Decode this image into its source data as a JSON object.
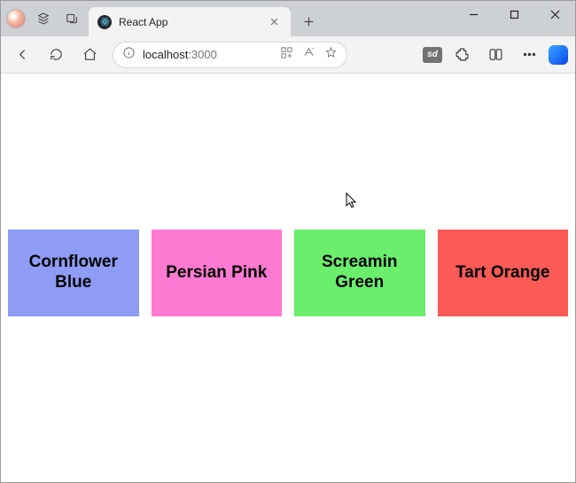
{
  "window": {
    "tab_title": "React App",
    "url_host": "localhost",
    "url_port": ":3000"
  },
  "swatches": [
    {
      "label": "Cornflower Blue",
      "color": "#8e9cf5"
    },
    {
      "label": "Persian Pink",
      "color": "#fc7ad1"
    },
    {
      "label": "Screamin Green",
      "color": "#6bee6b"
    },
    {
      "label": "Tart Orange",
      "color": "#fb5a56"
    }
  ],
  "icons": {
    "sd_label": "sd"
  }
}
